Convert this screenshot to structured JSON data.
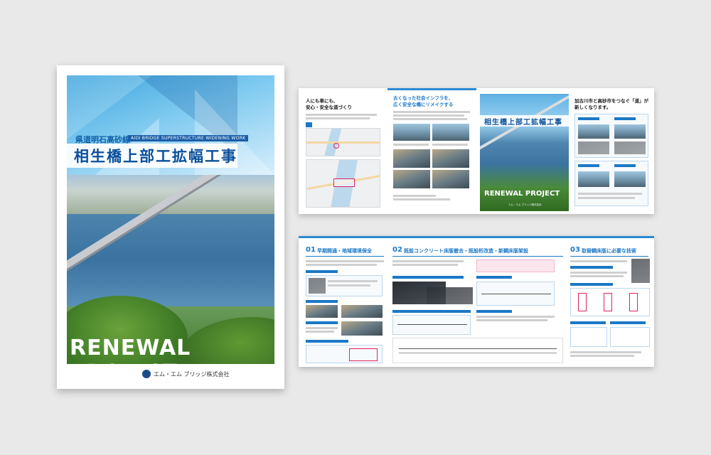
{
  "cover": {
    "subtitle_jp": "県道明石高砂線",
    "subtitle_en": "AIOI BRIDGE SUPERSTRUCTURE WIDENING WORK",
    "title": "相生橋上部工拡幅工事",
    "tagline": "RENEWAL PROJECT",
    "company": "エム・エム ブリッジ株式会社"
  },
  "spread_top": {
    "p1_heading": "人にも車にも、\n安心・安全な道づくり",
    "p2_heading": "古くなった社会インフラを、\n広く安全な橋にリメイクする",
    "mini_cover_title": "相生橋上部工拡幅工事",
    "mini_cover_tagline": "RENEWAL PROJECT",
    "mini_cover_company": "エム・エム ブリッジ株式会社",
    "p4_heading": "加古川市と高砂市をつなぐ「道」が\n新しくなります。"
  },
  "spread_bottom": {
    "s1_num": "01",
    "s1_title": "早期開通・地域環境保全",
    "s2_num": "02",
    "s2_title": "既設コンクリート床版撤去・既設桁改造・新鋼床版架設",
    "s3_num": "03",
    "s3_title": "取替鋼床版に必要な技術"
  },
  "colors": {
    "accent": "#1a78c8",
    "background": "#e9e9e9"
  }
}
